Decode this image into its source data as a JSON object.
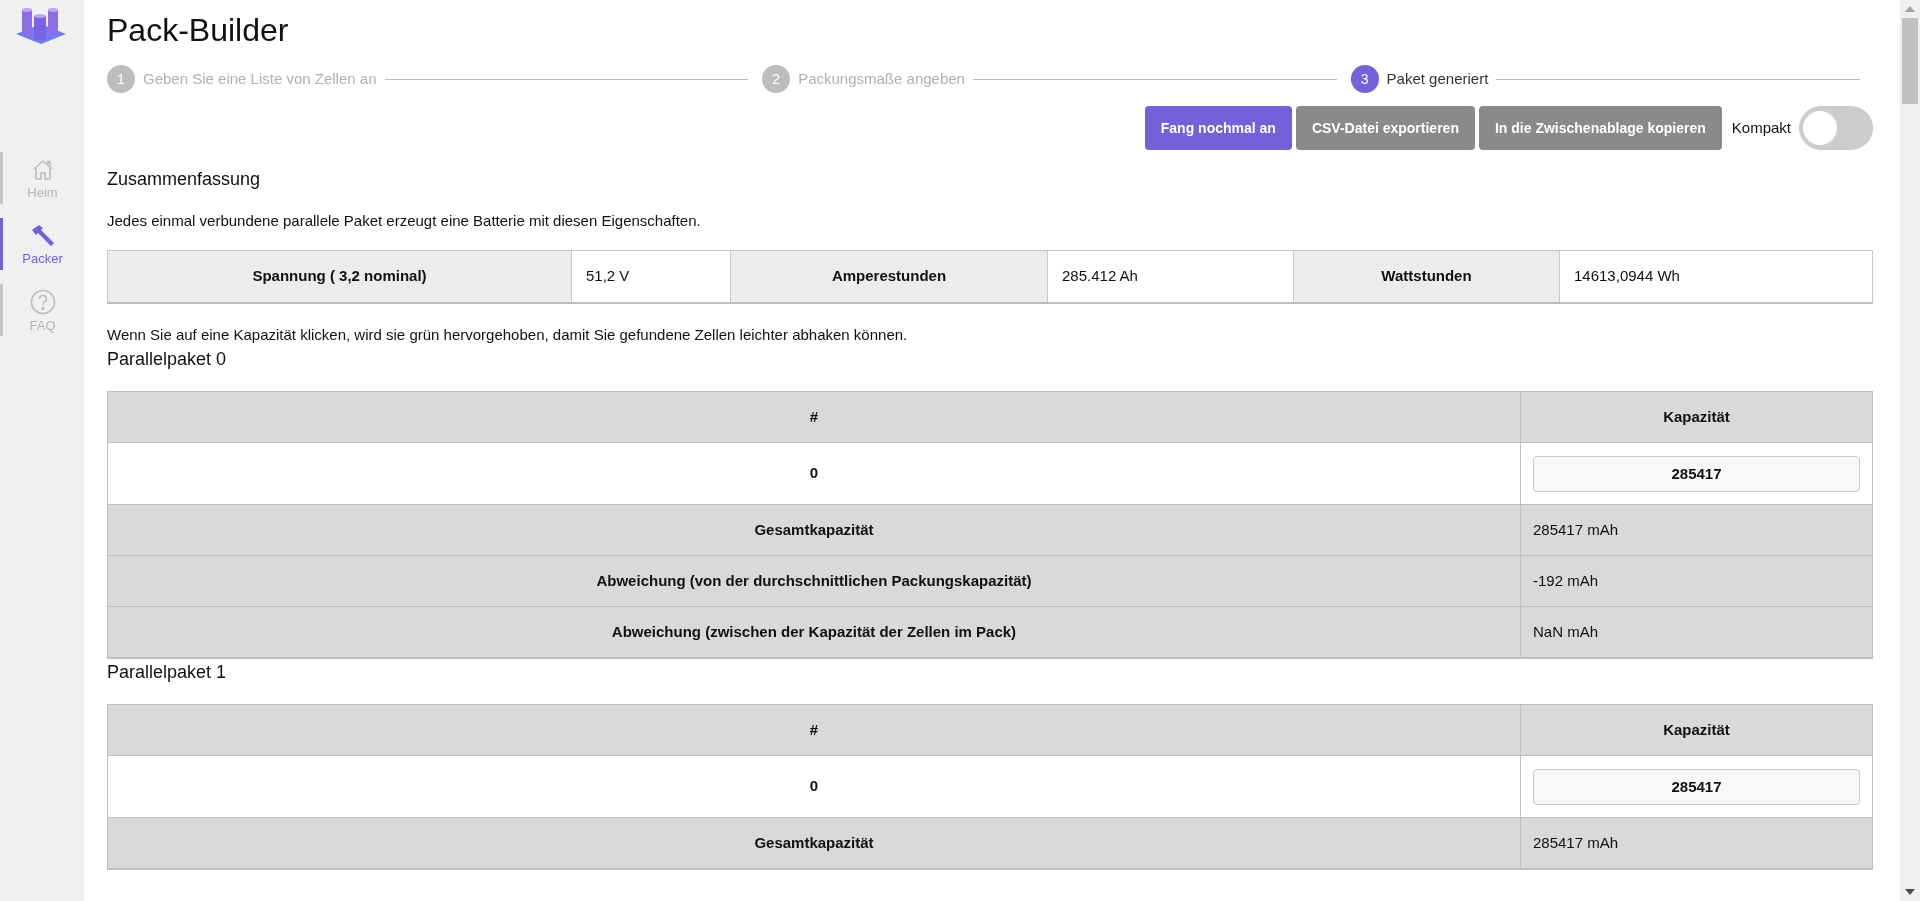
{
  "sidebar": {
    "items": [
      {
        "label": "Heim",
        "kind": "home",
        "selected": false
      },
      {
        "label": "Packer",
        "kind": "hammer",
        "selected": true
      },
      {
        "label": "FAQ",
        "kind": "help",
        "selected": false
      }
    ]
  },
  "title": "Pack-Builder",
  "steps": [
    {
      "number": "1",
      "label": "Geben Sie eine Liste von Zellen an",
      "selected": false
    },
    {
      "number": "2",
      "label": "Packungsmaße angeben",
      "selected": false
    },
    {
      "number": "3",
      "label": "Paket generiert",
      "selected": true
    }
  ],
  "actions": [
    {
      "label": "Fang nochmal an",
      "kind": "primary"
    },
    {
      "label": "CSV-Datei exportieren",
      "kind": "secondary"
    },
    {
      "label": "In die Zwischenablage kopieren",
      "kind": "secondary"
    }
  ],
  "compact": {
    "label": "Kompakt",
    "on": false
  },
  "summary": {
    "heading": "Zusammenfassung",
    "description": "Jedes einmal verbundene parallele Paket erzeugt eine Batterie mit diesen Eigenschaften.",
    "cells": [
      {
        "label": "Spannung ( 3,2 nominal)",
        "value": "51,2 V"
      },
      {
        "label": "Amperestunden",
        "value": "285.412 Ah"
      },
      {
        "label": "Wattstunden",
        "value": "14613,0944 Wh"
      }
    ]
  },
  "note": "Wenn Sie auf eine Kapazität klicken, wird sie grün hervorgehoben, damit Sie gefundene Zellen leichter abhaken können.",
  "packs": [
    {
      "title": "Parallelpaket 0",
      "columns": [
        "#",
        "Kapazität"
      ],
      "rows": [
        {
          "number": "0",
          "capacity": "285417"
        }
      ],
      "stats": [
        {
          "label": "Gesamtkapazität",
          "value": "285417 mAh"
        },
        {
          "label": "Abweichung (von der durchschnittlichen Packungskapazität)",
          "value": "-192 mAh"
        },
        {
          "label": "Abweichung (zwischen der Kapazität der Zellen im Pack)",
          "value": "NaN mAh"
        }
      ]
    },
    {
      "title": "Parallelpaket 1",
      "columns": [
        "#",
        "Kapazität"
      ],
      "rows": [
        {
          "number": "0",
          "capacity": "285417"
        }
      ],
      "stats": [
        {
          "label": "Gesamtkapazität",
          "value": "285417 mAh"
        }
      ]
    }
  ]
}
